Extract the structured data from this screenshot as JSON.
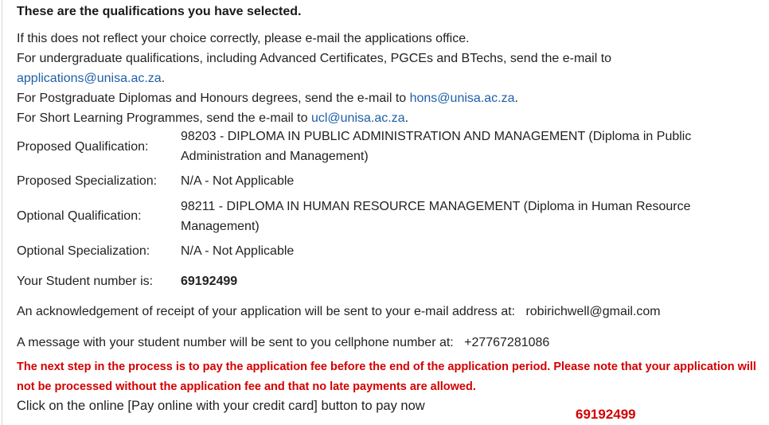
{
  "heading": "These are the qualifications you have selected.",
  "intro": {
    "line1": "If this does not reflect your choice correctly, please e-mail the applications office.",
    "line2_text": "For undergraduate qualifications, including Advanced Certificates, PGCEs and BTechs, send the e-mail to",
    "line2_email": "applications@unisa.ac.za",
    "line3_text": "For Postgraduate Diplomas and Honours degrees, send the e-mail to",
    "line3_email": "hons@unisa.ac.za",
    "line4_text": "For Short Learning Programmes, send the e-mail to",
    "line4_email": "ucl@unisa.ac.za",
    "period": "."
  },
  "details": {
    "proposed_qualification_label": "Proposed Qualification:",
    "proposed_qualification_value": "98203 - DIPLOMA IN PUBLIC ADMINISTRATION AND MANAGEMENT (Diploma in Public Administration and Management)",
    "proposed_specialization_label": "Proposed Specialization:",
    "proposed_specialization_value": "N/A - Not Applicable",
    "optional_qualification_label": "Optional Qualification:",
    "optional_qualification_value": "98211 - DIPLOMA IN HUMAN RESOURCE MANAGEMENT (Diploma in Human Resource Management)",
    "optional_specialization_label": "Optional Specialization:",
    "optional_specialization_value": "N/A - Not Applicable",
    "student_number_label": "Your Student number is:",
    "student_number_value": "69192499"
  },
  "notifications": {
    "email_text": "An acknowledgement of receipt of your application will be sent to your e-mail address at:",
    "email_value": "robirichwell@gmail.com",
    "cell_text": "A message with your student number will be sent to you cellphone number at:",
    "cell_value": "+27767281086"
  },
  "warning": "The next step in the process is to pay the application fee before the end of the application period. Please note that your application will not be processed without the application fee and that no late payments are allowed.",
  "pay_instruction": "Click on the online [Pay online with your credit card] button to pay now",
  "footer_number": "69192499",
  "colors": {
    "link": "#1f5fa8",
    "warning": "#d40000",
    "text": "#222222"
  }
}
